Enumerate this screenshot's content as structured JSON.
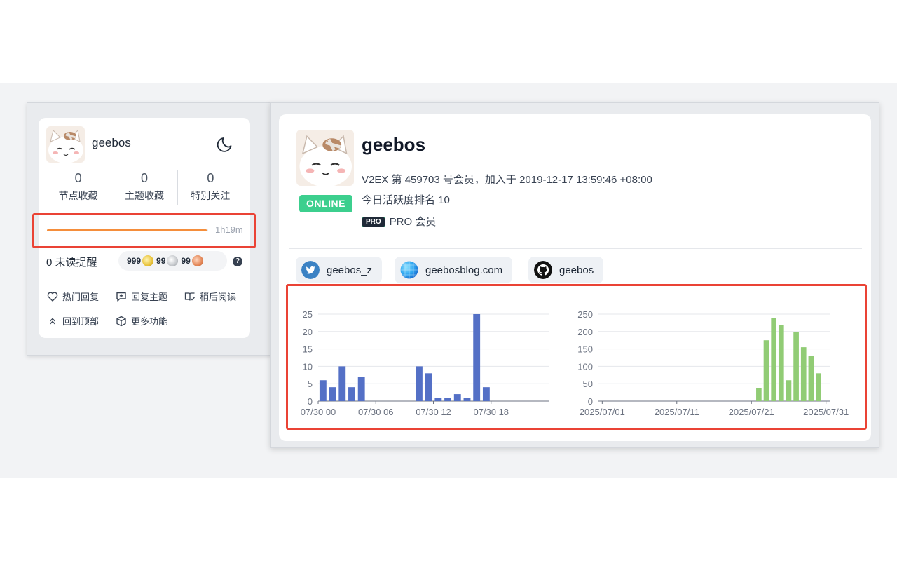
{
  "sidebar": {
    "username": "geebos",
    "stats": [
      {
        "value": "0",
        "label": "节点收藏"
      },
      {
        "value": "0",
        "label": "主题收藏"
      },
      {
        "value": "0",
        "label": "特别关注"
      }
    ],
    "progress": {
      "fraction": 0.99,
      "text": "1h19m"
    },
    "unread": "0 未读提醒",
    "balance": {
      "gold": "999",
      "silver": "99",
      "bronze": "99"
    },
    "help": "?",
    "actions": {
      "hot_replies": "热门回复",
      "reply_topic": "回复主题",
      "read_later": "稍后阅读",
      "back_to_top": "回到顶部",
      "more_features": "更多功能"
    }
  },
  "profile": {
    "username": "geebos",
    "status": "ONLINE",
    "member_info": "V2EX 第 459703 号会员，加入于 2019-12-17 13:59:46 +08:00",
    "activity_rank": "今日活跃度排名 10",
    "pro_badge": "PRO",
    "pro_label": "PRO 会员",
    "social": [
      {
        "icon": "twitter-icon",
        "text": "geebos_z"
      },
      {
        "icon": "globe-icon",
        "text": "geebosblog.com"
      },
      {
        "icon": "github-icon",
        "text": "geebos"
      }
    ]
  },
  "colors": {
    "accent_red": "#ea4335",
    "online_green": "#3ccf8e",
    "progress_orange": "#f58e3b",
    "bar_blue": "#5470c6",
    "bar_green": "#91cc75"
  },
  "chart_data": [
    {
      "type": "bar",
      "title": "",
      "x_unit": "hour",
      "x": [
        0,
        1,
        2,
        3,
        4,
        5,
        6,
        7,
        8,
        9,
        10,
        11,
        12,
        13,
        14,
        15,
        16,
        17,
        18,
        19,
        20,
        21,
        22,
        23
      ],
      "values": [
        6,
        4,
        10,
        4,
        7,
        0,
        0,
        0,
        0,
        0,
        10,
        8,
        1,
        1,
        2,
        1,
        25,
        4,
        0,
        0,
        0,
        0,
        0,
        0
      ],
      "xticks": [
        "07/30 00",
        "07/30 06",
        "07/30 12",
        "07/30 18"
      ],
      "xtick_positions": [
        0,
        6,
        12,
        18
      ],
      "yticks": [
        0,
        5,
        10,
        15,
        20,
        25
      ],
      "ylim": [
        0,
        25
      ],
      "color": "#5470c6",
      "grid": true
    },
    {
      "type": "bar",
      "title": "",
      "x_unit": "day",
      "x": [
        "2025/07/01",
        "2025/07/02",
        "2025/07/03",
        "2025/07/04",
        "2025/07/05",
        "2025/07/06",
        "2025/07/07",
        "2025/07/08",
        "2025/07/09",
        "2025/07/10",
        "2025/07/11",
        "2025/07/12",
        "2025/07/13",
        "2025/07/14",
        "2025/07/15",
        "2025/07/16",
        "2025/07/17",
        "2025/07/18",
        "2025/07/19",
        "2025/07/20",
        "2025/07/21",
        "2025/07/22",
        "2025/07/23",
        "2025/07/24",
        "2025/07/25",
        "2025/07/26",
        "2025/07/27",
        "2025/07/28",
        "2025/07/29",
        "2025/07/30",
        "2025/07/31"
      ],
      "values": [
        0,
        0,
        0,
        0,
        0,
        0,
        0,
        0,
        0,
        0,
        0,
        0,
        0,
        0,
        0,
        0,
        0,
        0,
        0,
        0,
        0,
        38,
        175,
        238,
        218,
        60,
        198,
        155,
        130,
        80,
        0
      ],
      "xticks": [
        "2025/07/01",
        "2025/07/11",
        "2025/07/21",
        "2025/07/31"
      ],
      "xtick_positions": [
        0,
        10,
        20,
        30
      ],
      "yticks": [
        0,
        50,
        100,
        150,
        200,
        250
      ],
      "ylim": [
        0,
        250
      ],
      "color": "#91cc75",
      "grid": true
    }
  ]
}
